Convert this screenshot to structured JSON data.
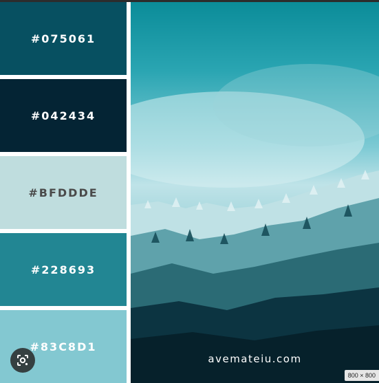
{
  "palette": [
    {
      "hex": "#075061",
      "label": "#075061",
      "text_color": "#ffffff"
    },
    {
      "hex": "#042434",
      "label": "#042434",
      "text_color": "#ffffff"
    },
    {
      "hex": "#BFDDDE",
      "label": "#BFDDDE",
      "text_color": "#4a4a4a"
    },
    {
      "hex": "#228693",
      "label": "#228693",
      "text_color": "#ffffff"
    },
    {
      "hex": "#83C8D1",
      "label": "#83C8D1",
      "text_color": "#ffffff"
    }
  ],
  "photo": {
    "watermark": "avemateiu.com"
  },
  "overlay": {
    "size_badge": "800 × 800",
    "lens_icon": "visual-search-icon"
  }
}
